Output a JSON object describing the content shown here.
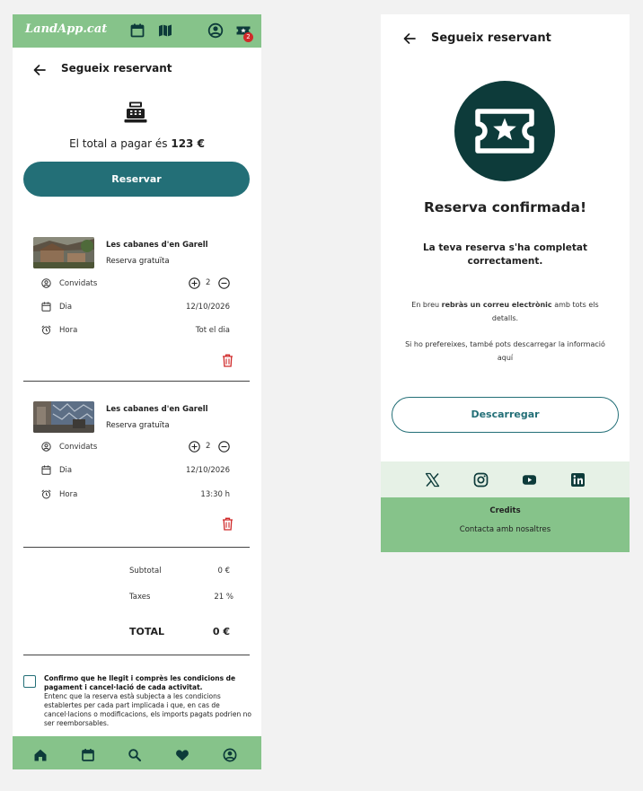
{
  "app": {
    "logo": "LandApp.cat",
    "ticket_badge": "2"
  },
  "left": {
    "title": "Segueix reservant",
    "total_prefix": "El total a pagar és ",
    "total_amount": "123 €",
    "reserve_button": "Reservar",
    "items": [
      {
        "title": "Les cabanes d'en Garell",
        "subtitle": "Reserva gratuïta",
        "guests_label": "Convidats",
        "guests_value": "2",
        "day_label": "Dia",
        "day_value": "12/10/2026",
        "time_label": "Hora",
        "time_value": "Tot el dia"
      },
      {
        "title": "Les cabanes d'en Garell",
        "subtitle": "Reserva gratuïta",
        "guests_label": "Convidats",
        "guests_value": "2",
        "day_label": "Dia",
        "day_value": "12/10/2026",
        "time_label": "Hora",
        "time_value": "13:30 h"
      }
    ],
    "summary": {
      "subtotal_label": "Subtotal",
      "subtotal_value": "0 €",
      "taxes_label": "Taxes",
      "taxes_value": "21 %",
      "total_label": "TOTAL",
      "total_value": "0 €"
    },
    "terms_bold": "Confirmo que he llegit i comprès les condicions de pagament i cancel·lació de cada activitat.",
    "terms_text": "Entenc que la reserva està subjecta a les condicions establertes per cada part implicada i que, en cas de cancel·lacions o modificacions, els imports pagats podrien no ser reemborsables."
  },
  "right": {
    "title": "Segueix reservant",
    "confirm_title": "Reserva confirmada!",
    "confirm_sub": "La teva reserva s'ha completat correctament.",
    "info_prefix": "En breu ",
    "info_bold": "rebràs un correu electrònic",
    "info_suffix": " amb tots els detalls.",
    "info2": "Si ho prefereixes, també pots descarregar la informació aquí",
    "download_button": "Descarregar",
    "credits": "Credits",
    "contact": "Contacta amb nosaltres"
  },
  "colors": {
    "green": "#86c38a",
    "teal": "#236f77",
    "dark": "#0d3b3a",
    "red": "#d02a2a"
  }
}
